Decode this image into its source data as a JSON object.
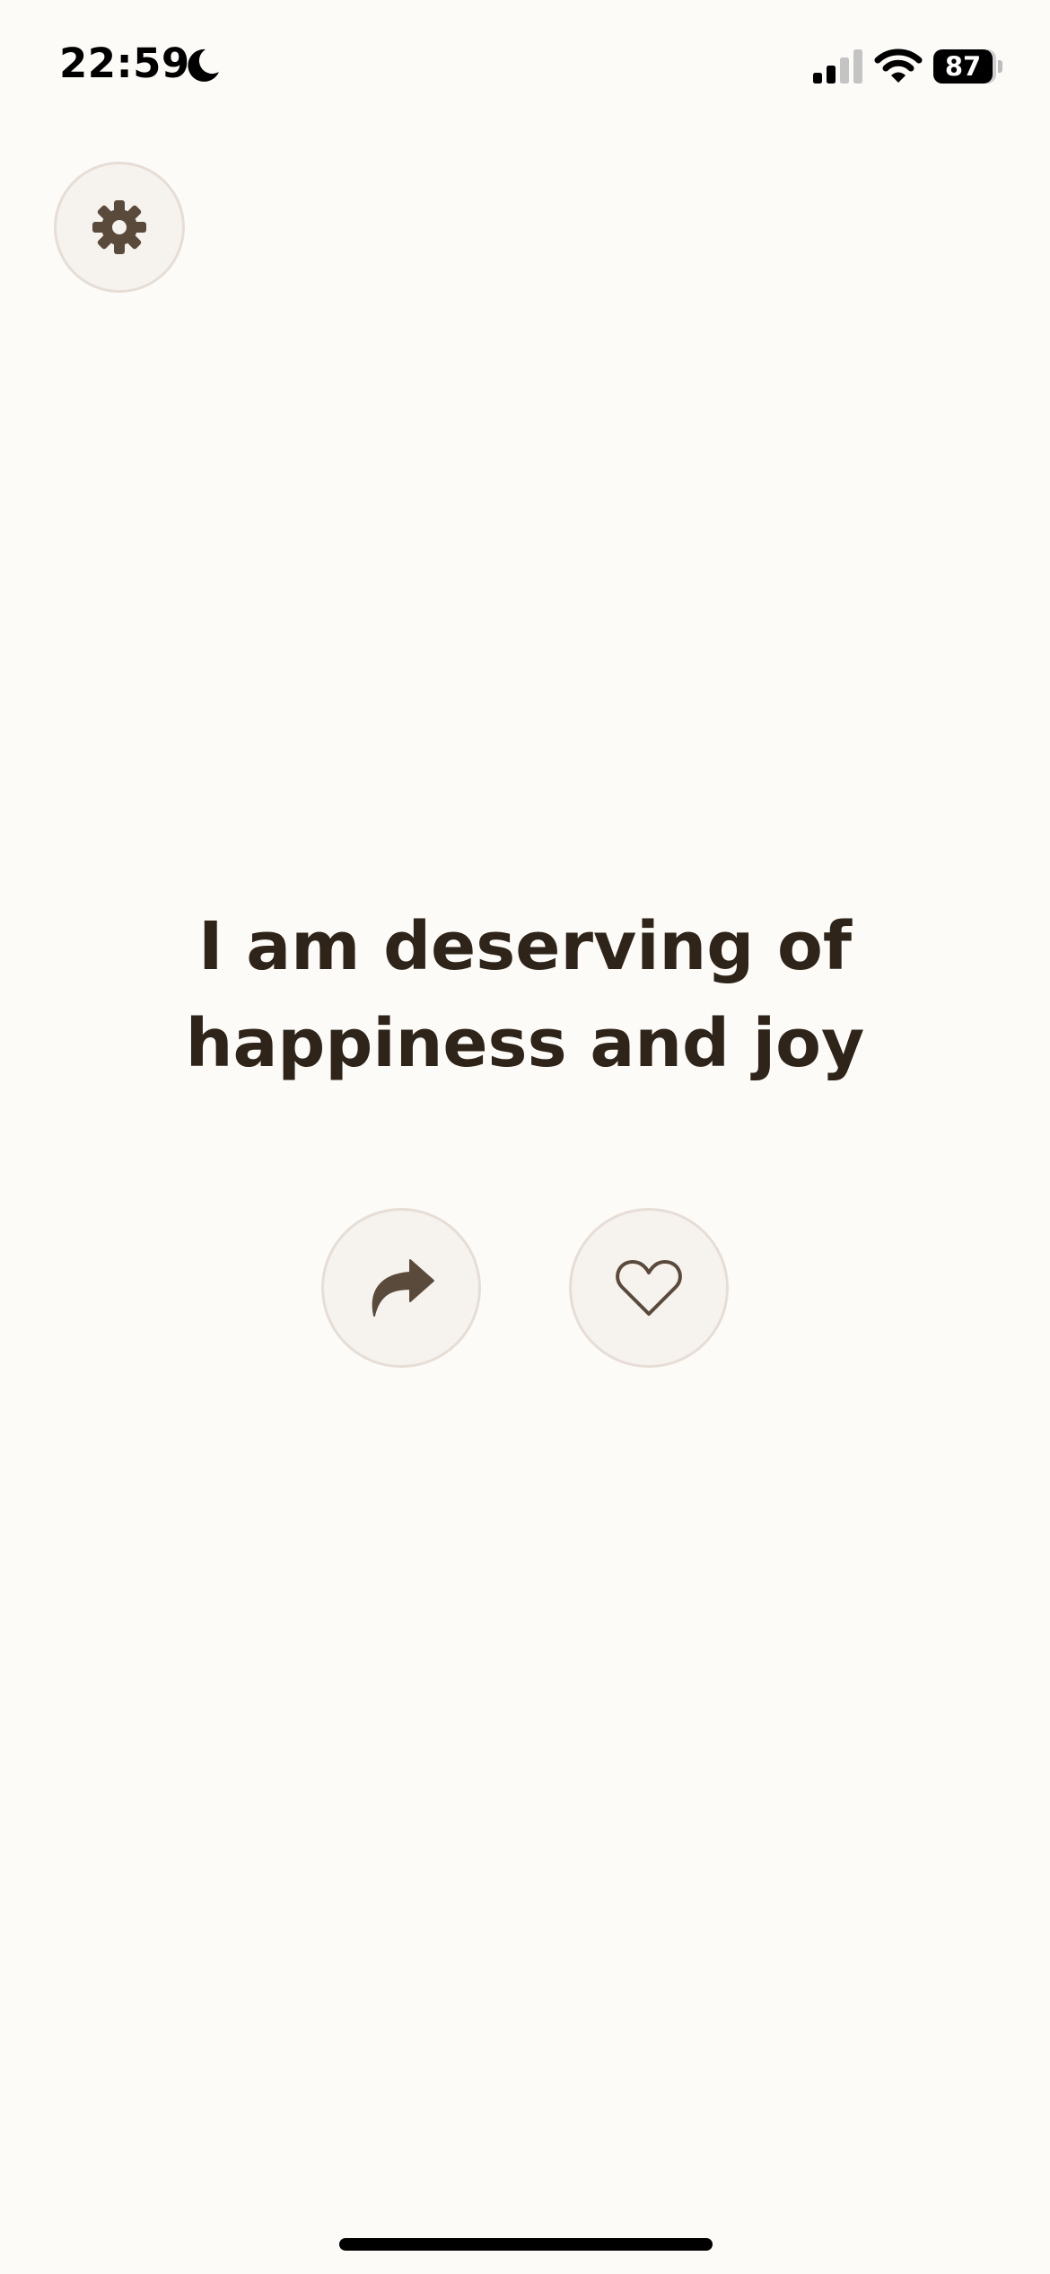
{
  "status_bar": {
    "time": "22:59",
    "battery_level": "87",
    "focus_icon": "moon-icon",
    "signal_icon": "cellular-signal-icon",
    "wifi_icon": "wifi-icon"
  },
  "toolbar": {
    "settings_icon": "gear-icon"
  },
  "affirmation": {
    "line1": "I am deserving of",
    "line2": "happiness and joy"
  },
  "actions": {
    "share_icon": "share-arrow-icon",
    "like_icon": "heart-icon"
  },
  "colors": {
    "background": "#fdfbf8",
    "button_fill": "#f6f2ee",
    "button_border": "#e6ded6",
    "icon": "#5a4a3c",
    "text": "#2e2419"
  }
}
